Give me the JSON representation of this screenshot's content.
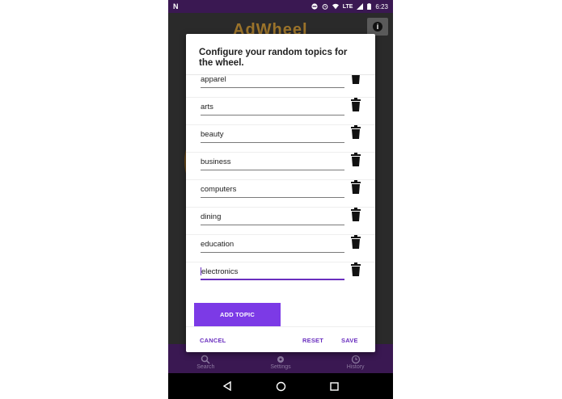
{
  "status_bar": {
    "network_label": "LTE",
    "time": "6:23"
  },
  "app": {
    "logo_text": "AdWheel",
    "info_icon": "i"
  },
  "dialog": {
    "title": "Configure your random topics for the wheel.",
    "topics": [
      "apparel",
      "arts",
      "beauty",
      "business",
      "computers",
      "dining",
      "education",
      "electronics"
    ],
    "add_label": "ADD TOPIC",
    "cancel_label": "CANCEL",
    "reset_label": "RESET",
    "save_label": "SAVE"
  },
  "bottom_nav": {
    "items": [
      {
        "label": "Search",
        "icon": "search-icon"
      },
      {
        "label": "Settings",
        "icon": "gear-icon"
      },
      {
        "label": "History",
        "icon": "clock-icon"
      }
    ]
  },
  "colors": {
    "accent": "#7c3ae6",
    "status_bar": "#3a1852",
    "text_accent": "#6a2fbf"
  }
}
